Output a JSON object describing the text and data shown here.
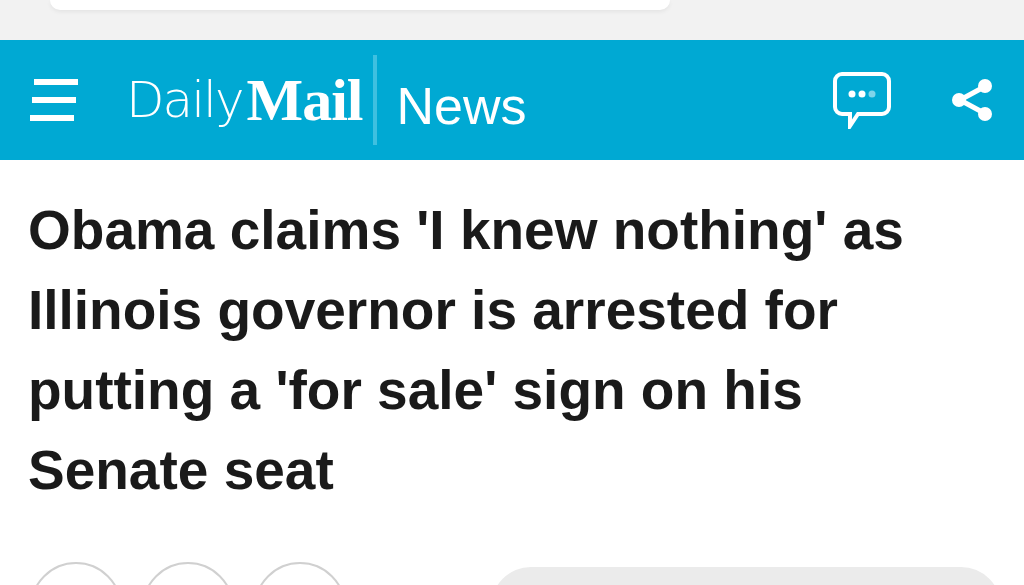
{
  "header": {
    "logo": {
      "word_1": "Daily",
      "word_2": "Mail"
    },
    "section": "News"
  },
  "article": {
    "headline": "Obama claims 'I knew nothing' as Illinois governor is arrested for putting a 'for sale' sign on his Senate seat"
  }
}
